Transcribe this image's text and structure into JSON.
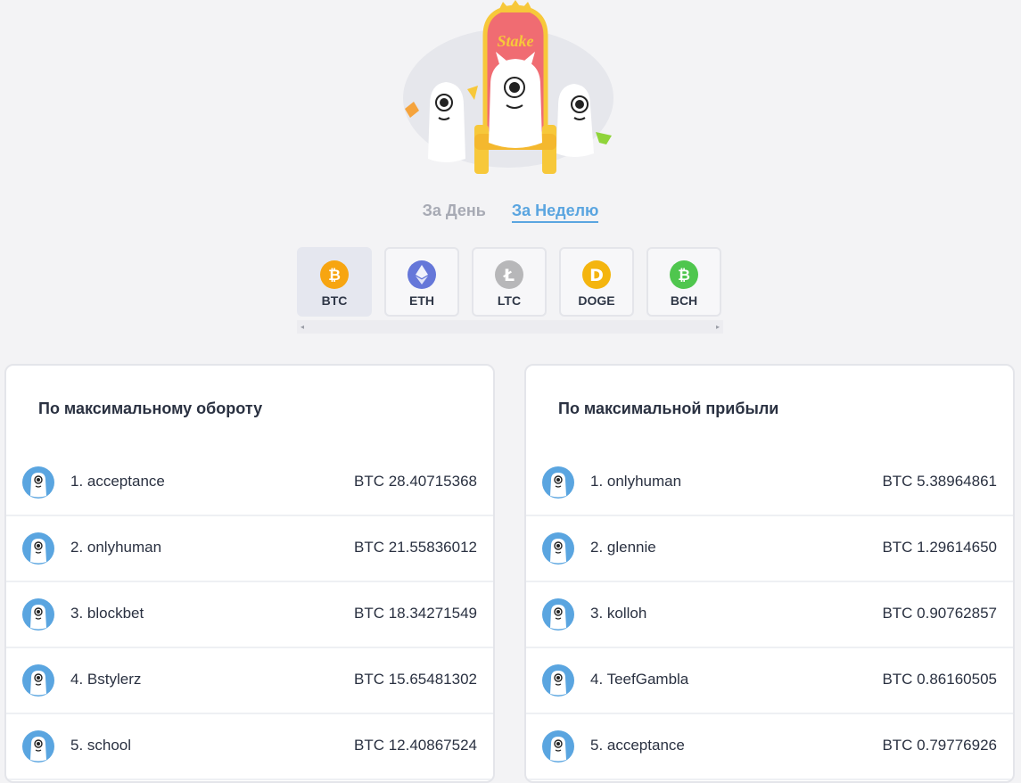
{
  "header": {
    "logo_text": "Stake",
    "mascot": "stake-throne-mascots"
  },
  "period_tabs": [
    {
      "label": "За День",
      "active": false
    },
    {
      "label": "За Неделю",
      "active": true
    }
  ],
  "currencies": [
    {
      "code": "BTC",
      "icon": "bitcoin-icon",
      "color": "#f7a511",
      "glyph": "₿",
      "selected": true
    },
    {
      "code": "ETH",
      "icon": "ethereum-icon",
      "color": "#6577d9",
      "glyph": "◆",
      "selected": false
    },
    {
      "code": "LTC",
      "icon": "litecoin-icon",
      "color": "#b7b7b9",
      "glyph": "Ł",
      "selected": false
    },
    {
      "code": "DOGE",
      "icon": "dogecoin-icon",
      "color": "#f4b50f",
      "glyph": "D",
      "selected": false
    },
    {
      "code": "BCH",
      "icon": "bitcoin-cash-icon",
      "color": "#4fc64e",
      "glyph": "₿",
      "selected": false
    }
  ],
  "scrollbar": {
    "left_arrow": "◂",
    "right_arrow": "▸"
  },
  "leaderboards": {
    "turnover": {
      "title": "По максимальному обороту",
      "rows": [
        {
          "rank_name": "1. acceptance",
          "amount": "BTC 28.40715368"
        },
        {
          "rank_name": "2. onlyhuman",
          "amount": "BTC 21.55836012"
        },
        {
          "rank_name": "3. blockbet",
          "amount": "BTC 18.34271549"
        },
        {
          "rank_name": "4. Bstylerz",
          "amount": "BTC 15.65481302"
        },
        {
          "rank_name": "5. school",
          "amount": "BTC 12.40867524"
        }
      ]
    },
    "profit": {
      "title": "По максимальной прибыли",
      "rows": [
        {
          "rank_name": "1. onlyhuman",
          "amount": "BTC 5.38964861"
        },
        {
          "rank_name": "2. glennie",
          "amount": "BTC 1.29614650"
        },
        {
          "rank_name": "3. kolloh",
          "amount": "BTC 0.90762857"
        },
        {
          "rank_name": "4. TeefGambla",
          "amount": "BTC 0.86160505"
        },
        {
          "rank_name": "5. acceptance",
          "amount": "BTC 0.79776926"
        }
      ]
    }
  },
  "colors": {
    "accent": "#5aa5e0",
    "inactive_tab": "#a7aab4",
    "avatar_ring": "#5aa5e0"
  }
}
